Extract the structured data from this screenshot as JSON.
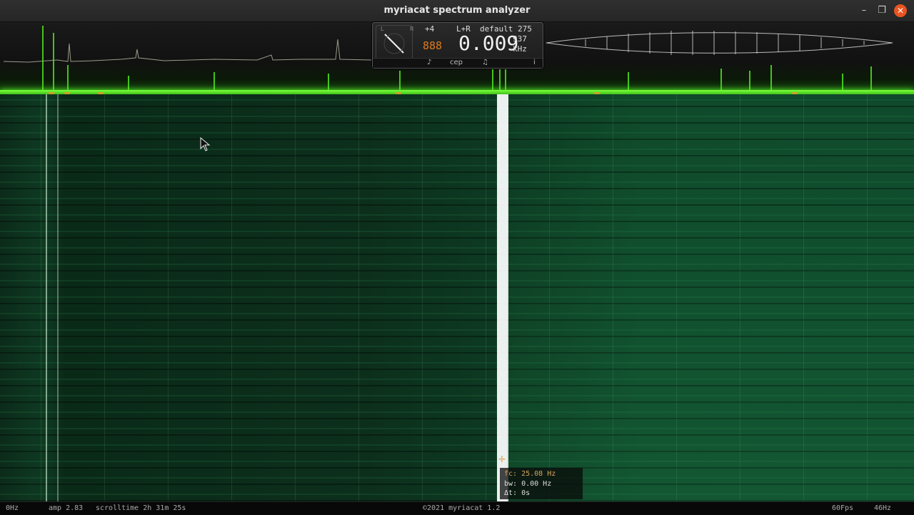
{
  "window": {
    "title": "myriacat spectrum analyzer",
    "controls": {
      "minimize": "–",
      "maximize": "❐",
      "close": "✕"
    }
  },
  "hud": {
    "channel_left": "L",
    "channel_right": "R",
    "transpose": "+4",
    "channel_mode": "L+R",
    "preset": "default",
    "preset_value": "275",
    "segment": "888",
    "frequency": "0.009",
    "freq_fraction": "937",
    "freq_unit": "kHz",
    "buttons": {
      "bass": "♪",
      "cepstrum": "cep",
      "note": "♫",
      "info": "i"
    }
  },
  "readout": {
    "fc": "fc: 25.08 Hz",
    "bw": "bw: 0.00 Hz",
    "dt": "Δt: 0s"
  },
  "status": {
    "min_freq": "0Hz",
    "amp": "amp 2.83",
    "scrolltime": "scrolltime 2h 31m 25s",
    "copyright": "©2021 myriacat 1.2",
    "fps": "60Fps",
    "max_freq": "46Hz"
  },
  "colors": {
    "spectrum_green": "#5cff2a",
    "marker": "#c9a227",
    "close_button": "#e95420",
    "waterfall_base": "#0f3a22",
    "readout_text": "#d9a35a"
  },
  "icons": [
    "minimize-icon",
    "maximize-icon",
    "close-icon",
    "mouse-pointer-icon",
    "crosshair-icon",
    "needle-meter-icon"
  ]
}
